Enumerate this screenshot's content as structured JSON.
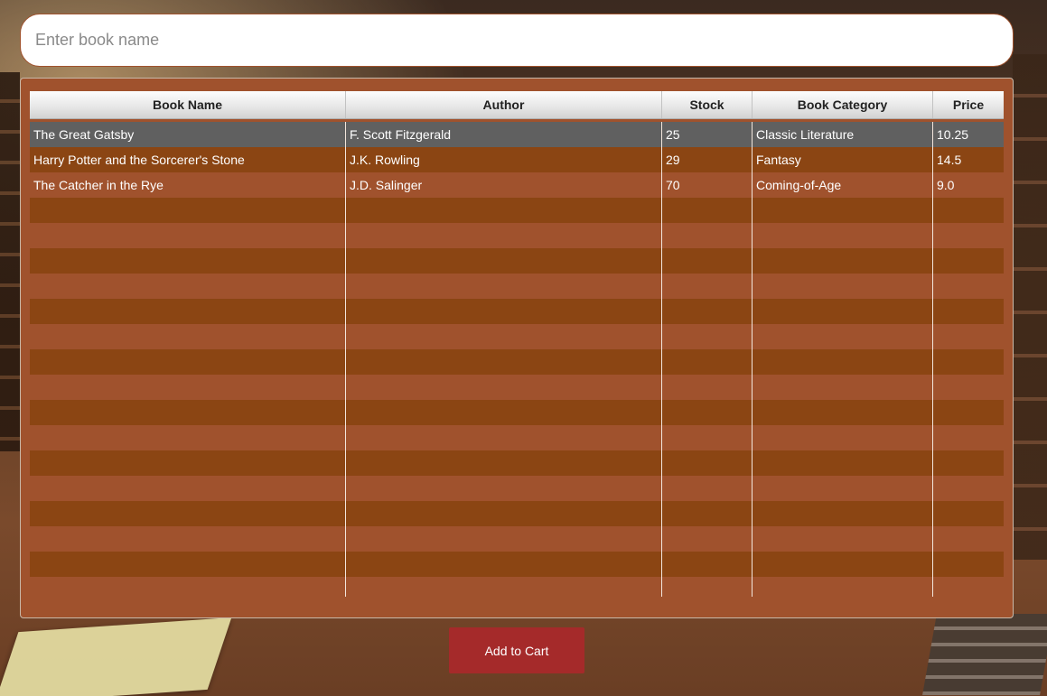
{
  "search": {
    "placeholder": "Enter book name",
    "value": ""
  },
  "table": {
    "columns": [
      "Book Name",
      "Author",
      "Stock",
      "Book Category",
      "Price"
    ],
    "rows": [
      {
        "name": "The Great Gatsby",
        "author": "F. Scott Fitzgerald",
        "stock": "25",
        "category": "Classic Literature",
        "price": "10.25",
        "selected": true
      },
      {
        "name": "Harry Potter and the Sorcerer's Stone",
        "author": "J.K. Rowling",
        "stock": "29",
        "category": "Fantasy",
        "price": "14.5",
        "selected": false
      },
      {
        "name": "The Catcher in the Rye",
        "author": "J.D. Salinger",
        "stock": "70",
        "category": "Coming-of-Age",
        "price": "9.0",
        "selected": false
      }
    ]
  },
  "actions": {
    "add_to_cart_label": "Add to Cart"
  },
  "colors": {
    "panel": "#a0522d",
    "row_alt": "#8b4513",
    "row_selected": "#606060",
    "button": "#a52a2a"
  }
}
